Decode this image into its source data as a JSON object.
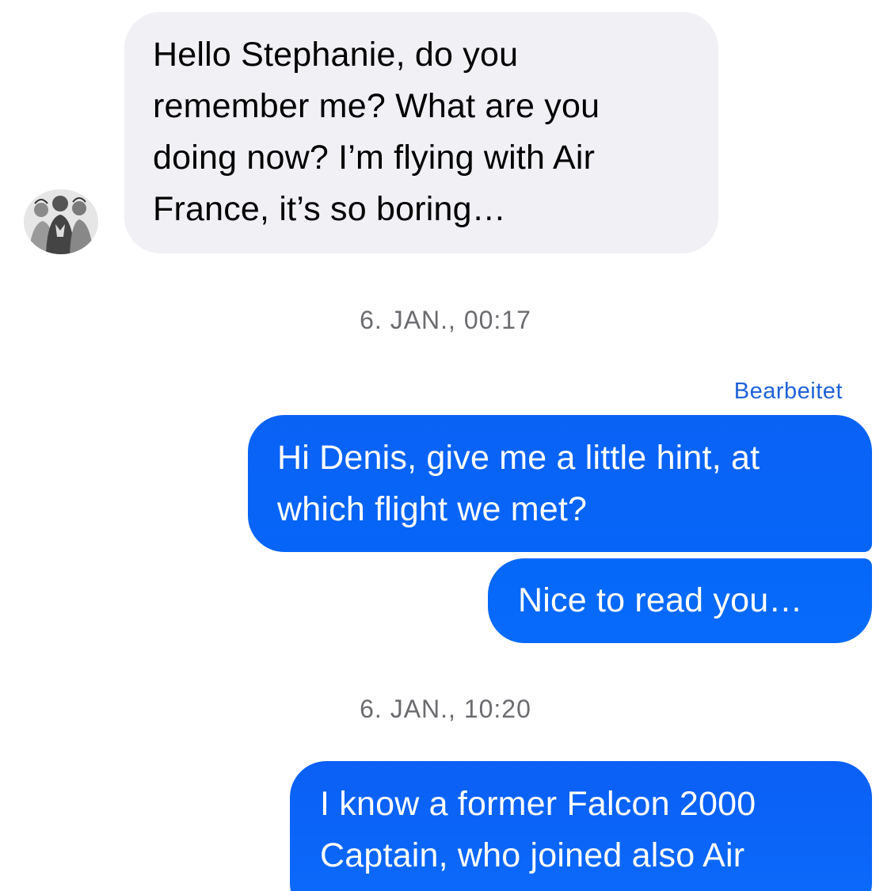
{
  "conversation": {
    "incoming": {
      "avatar_icon": "group-photo-avatar",
      "message_lines": [
        "Hello Stephanie, do you",
        "remember me? What are you",
        "doing now? I’m flying with Air",
        "France, it’s so boring…"
      ]
    },
    "timestamps": [
      "6. JAN., 00:17",
      "6. JAN., 10:20"
    ],
    "edited_label": "Bearbeitet",
    "outgoing": [
      {
        "message_lines": [
          "Hi Denis, give me a little hint, at",
          "which flight we met?"
        ]
      },
      {
        "message_lines": [
          "Nice to read you…"
        ]
      },
      {
        "message_lines": [
          "I know a former Falcon 2000",
          "Captain, who joined also Air"
        ]
      }
    ]
  },
  "colors": {
    "incoming_bubble": "#f0f0f5",
    "outgoing_bubble": "#0a64f7",
    "timestamp_text": "#6c6c70",
    "edited_text": "#1f62d8"
  }
}
